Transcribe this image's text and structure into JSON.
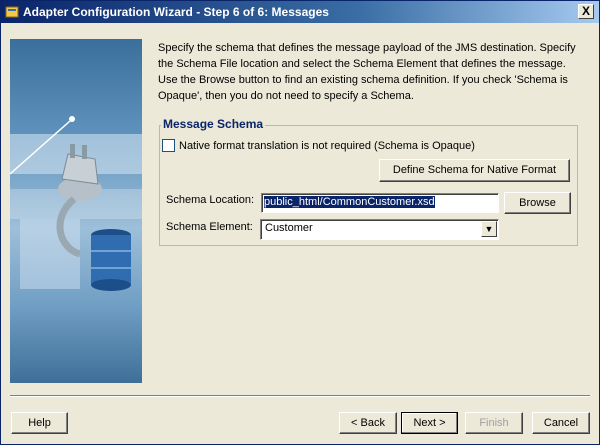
{
  "window": {
    "title": "Adapter Configuration Wizard - Step 6 of 6: Messages",
    "close_label": "X"
  },
  "intro": "Specify the schema that defines the message payload of the JMS destination.  Specify the Schema File location and select the Schema Element that defines the message. Use the Browse button to find an existing schema definition. If you check 'Schema is Opaque', then you do not need to specify a Schema.",
  "schema_group": {
    "title": "Message Schema",
    "opaque_checkbox_label": "Native format translation is not required (Schema is Opaque)",
    "opaque_checked": false,
    "define_button": "Define Schema for Native Format",
    "location_label": "Schema Location:",
    "location_value": "public_html/CommonCustomer.xsd",
    "browse_button": "Browse",
    "element_label": "Schema Element:",
    "element_value": "Customer"
  },
  "footer": {
    "help": "Help",
    "back": "< Back",
    "next": "Next >",
    "finish": "Finish",
    "cancel": "Cancel"
  }
}
